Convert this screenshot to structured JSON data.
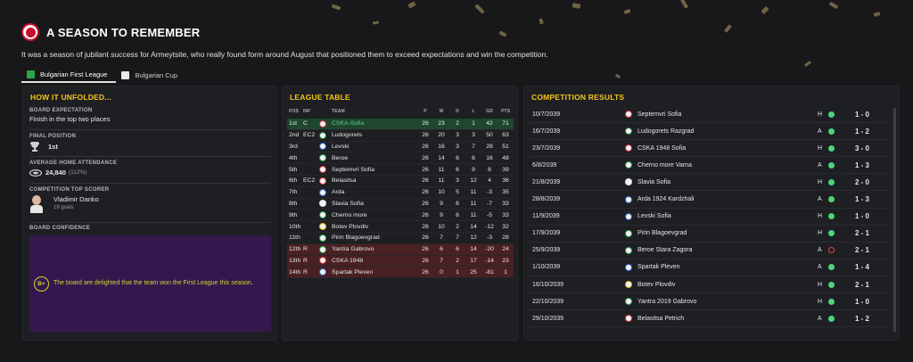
{
  "header": {
    "title": "A SEASON TO REMEMBER",
    "subtitle": "It was a season of jubilant success for Armeytsite, who really found form around August that positioned them to exceed expectations and win the competition.",
    "tabs": [
      {
        "label": "Bulgarian First League",
        "active": true
      },
      {
        "label": "Bulgarian Cup",
        "active": false
      }
    ]
  },
  "how_it_unfolded": {
    "title": "HOW IT UNFOLDED...",
    "board_expectation_label": "BOARD EXPECTATION",
    "board_expectation_value": "Finish in the top two places",
    "final_position_label": "FINAL POSITION",
    "final_position_value": "1st",
    "attendance_label": "AVERAGE HOME ATTENDANCE",
    "attendance_value": "24,840",
    "attendance_pct": "(112%)",
    "top_scorer_label": "COMPETITION TOP SCORER",
    "top_scorer_name": "Vladimir Danko",
    "top_scorer_goals": "19 goals",
    "board_confidence_label": "BOARD CONFIDENCE",
    "board_confidence_grade": "B+",
    "board_confidence_text": "The board are delighted that the team won the First League this season."
  },
  "league_table": {
    "title": "LEAGUE TABLE",
    "columns": [
      "POS",
      "INF",
      "TEAM",
      "P",
      "W",
      "D",
      "L",
      "GD",
      "PTS"
    ],
    "rows": [
      {
        "pos": "1st",
        "inf": "C",
        "team": "CSKA-Sofia",
        "p": "26",
        "w": "23",
        "d": "2",
        "l": "1",
        "gd": "42",
        "pts": "71",
        "status": "champ",
        "color": "#d42d3a"
      },
      {
        "pos": "2nd",
        "inf": "EC2",
        "team": "Ludogorets",
        "p": "26",
        "w": "20",
        "d": "3",
        "l": "3",
        "gd": "50",
        "pts": "63",
        "status": "",
        "color": "#1a8a3a"
      },
      {
        "pos": "3rd",
        "inf": "",
        "team": "Levski",
        "p": "26",
        "w": "16",
        "d": "3",
        "l": "7",
        "gd": "28",
        "pts": "51",
        "status": "",
        "color": "#2a5fd4"
      },
      {
        "pos": "4th",
        "inf": "",
        "team": "Beroe",
        "p": "26",
        "w": "14",
        "d": "6",
        "l": "6",
        "gd": "16",
        "pts": "48",
        "status": "",
        "color": "#2fa54a"
      },
      {
        "pos": "5th",
        "inf": "",
        "team": "Septemvri Sofia",
        "p": "26",
        "w": "11",
        "d": "6",
        "l": "9",
        "gd": "8",
        "pts": "39",
        "status": "",
        "color": "#d42d3a"
      },
      {
        "pos": "6th",
        "inf": "EC2",
        "team": "Belasitsa",
        "p": "26",
        "w": "11",
        "d": "3",
        "l": "12",
        "gd": "4",
        "pts": "36",
        "status": "",
        "color": "#e04040"
      },
      {
        "pos": "7th",
        "inf": "",
        "team": "Arda",
        "p": "26",
        "w": "10",
        "d": "5",
        "l": "11",
        "gd": "-3",
        "pts": "35",
        "status": "",
        "color": "#3a6ed8"
      },
      {
        "pos": "8th",
        "inf": "",
        "team": "Slavia Sofia",
        "p": "26",
        "w": "9",
        "d": "6",
        "l": "11",
        "gd": "-7",
        "pts": "33",
        "status": "",
        "color": "#e8e8e8"
      },
      {
        "pos": "9th",
        "inf": "",
        "team": "Cherno more",
        "p": "26",
        "w": "9",
        "d": "6",
        "l": "11",
        "gd": "-5",
        "pts": "33",
        "status": "",
        "color": "#2a9a4a"
      },
      {
        "pos": "10th",
        "inf": "",
        "team": "Botev Plovdiv",
        "p": "26",
        "w": "10",
        "d": "2",
        "l": "14",
        "gd": "-12",
        "pts": "32",
        "status": "",
        "color": "#d8b820"
      },
      {
        "pos": "11th",
        "inf": "",
        "team": "Pirin Blagoevgrad",
        "p": "26",
        "w": "7",
        "d": "7",
        "l": "12",
        "gd": "-3",
        "pts": "28",
        "status": "",
        "color": "#2fa54a"
      },
      {
        "pos": "12th",
        "inf": "R",
        "team": "Yantra Gabrovo",
        "p": "26",
        "w": "6",
        "d": "6",
        "l": "14",
        "gd": "-20",
        "pts": "24",
        "status": "releg",
        "color": "#2fa54a"
      },
      {
        "pos": "13th",
        "inf": "R",
        "team": "CSKA 1948",
        "p": "26",
        "w": "7",
        "d": "2",
        "l": "17",
        "gd": "-14",
        "pts": "23",
        "status": "releg",
        "color": "#d42d3a"
      },
      {
        "pos": "14th",
        "inf": "R",
        "team": "Spartak Pleven",
        "p": "26",
        "w": "0",
        "d": "1",
        "l": "25",
        "gd": "-81",
        "pts": "1",
        "status": "releg",
        "color": "#3a6ed8"
      }
    ]
  },
  "results": {
    "title": "COMPETITION RESULTS",
    "rows": [
      {
        "date": "10/7/2039",
        "team": "Septemvri Sofia",
        "ha": "H",
        "outcome": "w",
        "score": "1 - 0",
        "color": "#d42d3a"
      },
      {
        "date": "16/7/2039",
        "team": "Ludogorets Razgrad",
        "ha": "A",
        "outcome": "w",
        "score": "1 - 2",
        "color": "#1a8a3a"
      },
      {
        "date": "23/7/2039",
        "team": "CSKA 1948 Sofia",
        "ha": "H",
        "outcome": "w",
        "score": "3 - 0",
        "color": "#d42d3a"
      },
      {
        "date": "6/8/2039",
        "team": "Cherno more Varna",
        "ha": "A",
        "outcome": "w",
        "score": "1 - 3",
        "color": "#2a9a4a"
      },
      {
        "date": "21/8/2039",
        "team": "Slavia Sofia",
        "ha": "H",
        "outcome": "w",
        "score": "2 - 0",
        "color": "#e8e8e8"
      },
      {
        "date": "28/8/2039",
        "team": "Arda 1924 Kardzhali",
        "ha": "A",
        "outcome": "w",
        "score": "1 - 3",
        "color": "#3a6ed8"
      },
      {
        "date": "11/9/2039",
        "team": "Levski Sofia",
        "ha": "H",
        "outcome": "w",
        "score": "1 - 0",
        "color": "#2a5fd4"
      },
      {
        "date": "17/9/2039",
        "team": "Pirin Blagoevgrad",
        "ha": "H",
        "outcome": "w",
        "score": "2 - 1",
        "color": "#2fa54a"
      },
      {
        "date": "25/9/2039",
        "team": "Beroe Stara Zagora",
        "ha": "A",
        "outcome": "l",
        "score": "2 - 1",
        "color": "#2fa54a"
      },
      {
        "date": "1/10/2039",
        "team": "Spartak Pleven",
        "ha": "A",
        "outcome": "w",
        "score": "1 - 4",
        "color": "#3a6ed8"
      },
      {
        "date": "16/10/2039",
        "team": "Botev Plovdiv",
        "ha": "H",
        "outcome": "w",
        "score": "2 - 1",
        "color": "#d8b820"
      },
      {
        "date": "22/10/2039",
        "team": "Yantra 2019 Gabrovo",
        "ha": "H",
        "outcome": "w",
        "score": "1 - 0",
        "color": "#2fa54a"
      },
      {
        "date": "29/10/2039",
        "team": "Belasitsa Petrich",
        "ha": "A",
        "outcome": "w",
        "score": "1 - 2",
        "color": "#e04040"
      }
    ]
  }
}
